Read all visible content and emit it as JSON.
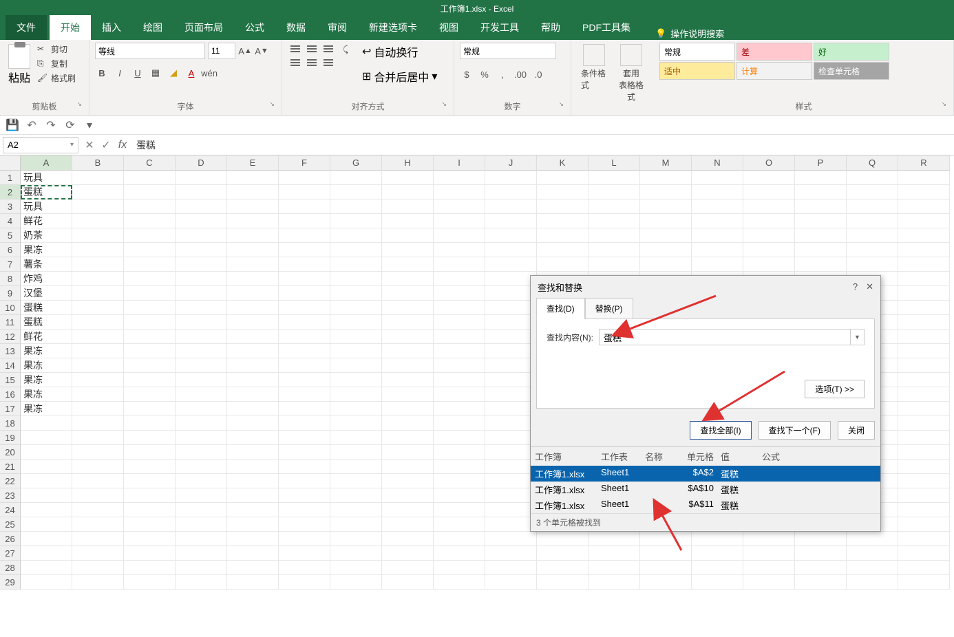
{
  "title": "工作簿1.xlsx - Excel",
  "tabs": {
    "file": "文件",
    "home": "开始",
    "insert": "插入",
    "draw": "绘图",
    "layout": "页面布局",
    "formulas": "公式",
    "data": "数据",
    "review": "审阅",
    "newtab": "新建选项卡",
    "view": "视图",
    "dev": "开发工具",
    "help": "帮助",
    "pdf": "PDF工具集"
  },
  "tell_me": "操作说明搜索",
  "clipboard": {
    "paste": "粘贴",
    "cut": "剪切",
    "copy": "复制",
    "painter": "格式刷",
    "label": "剪贴板"
  },
  "font": {
    "name": "等线",
    "size": "11",
    "label": "字体",
    "bold": "B",
    "italic": "I",
    "underline": "U"
  },
  "align": {
    "wrap": "自动换行",
    "merge": "合并后居中",
    "label": "对齐方式"
  },
  "number": {
    "format": "常规",
    "label": "数字"
  },
  "cond": {
    "cond_fmt": "条件格式",
    "table_fmt": "套用\n表格格式"
  },
  "styles": {
    "normal": "常规",
    "bad": "差",
    "good": "好",
    "neutral": "适中",
    "calc": "计算",
    "check": "检查单元格",
    "label": "样式"
  },
  "name_box": "A2",
  "formula_value": "蛋糕",
  "columns": [
    "A",
    "B",
    "C",
    "D",
    "E",
    "F",
    "G",
    "H",
    "I",
    "J",
    "K",
    "L",
    "M",
    "N",
    "O",
    "P",
    "Q",
    "R"
  ],
  "rows": [
    {
      "n": 1,
      "a": "玩具"
    },
    {
      "n": 2,
      "a": "蛋糕"
    },
    {
      "n": 3,
      "a": "玩具"
    },
    {
      "n": 4,
      "a": "鲜花"
    },
    {
      "n": 5,
      "a": "奶茶"
    },
    {
      "n": 6,
      "a": "果冻"
    },
    {
      "n": 7,
      "a": "薯条"
    },
    {
      "n": 8,
      "a": "炸鸡"
    },
    {
      "n": 9,
      "a": "汉堡"
    },
    {
      "n": 10,
      "a": "蛋糕"
    },
    {
      "n": 11,
      "a": "蛋糕"
    },
    {
      "n": 12,
      "a": "鲜花"
    },
    {
      "n": 13,
      "a": "果冻"
    },
    {
      "n": 14,
      "a": "果冻"
    },
    {
      "n": 15,
      "a": "果冻"
    },
    {
      "n": 16,
      "a": "果冻"
    },
    {
      "n": 17,
      "a": "果冻"
    },
    {
      "n": 18,
      "a": ""
    },
    {
      "n": 19,
      "a": ""
    },
    {
      "n": 20,
      "a": ""
    },
    {
      "n": 21,
      "a": ""
    },
    {
      "n": 22,
      "a": ""
    },
    {
      "n": 23,
      "a": ""
    },
    {
      "n": 24,
      "a": ""
    },
    {
      "n": 25,
      "a": ""
    },
    {
      "n": 26,
      "a": ""
    },
    {
      "n": 27,
      "a": ""
    },
    {
      "n": 28,
      "a": ""
    },
    {
      "n": 29,
      "a": ""
    }
  ],
  "selected_row": 2,
  "dialog": {
    "title": "查找和替换",
    "tab_find": "查找(D)",
    "tab_replace": "替换(P)",
    "find_label": "查找内容(N):",
    "find_value": "蛋糕",
    "options": "选项(T) >>",
    "find_all": "查找全部(I)",
    "find_next": "查找下一个(F)",
    "close": "关闭",
    "cols": {
      "workbook": "工作簿",
      "sheet": "工作表",
      "name": "名称",
      "cell": "单元格",
      "value": "值",
      "formula": "公式"
    },
    "results": [
      {
        "wb": "工作簿1.xlsx",
        "sh": "Sheet1",
        "nm": "",
        "cell": "$A$2",
        "val": "蛋糕",
        "fm": ""
      },
      {
        "wb": "工作簿1.xlsx",
        "sh": "Sheet1",
        "nm": "",
        "cell": "$A$10",
        "val": "蛋糕",
        "fm": ""
      },
      {
        "wb": "工作簿1.xlsx",
        "sh": "Sheet1",
        "nm": "",
        "cell": "$A$11",
        "val": "蛋糕",
        "fm": ""
      }
    ],
    "status": "3 个单元格被找到"
  }
}
